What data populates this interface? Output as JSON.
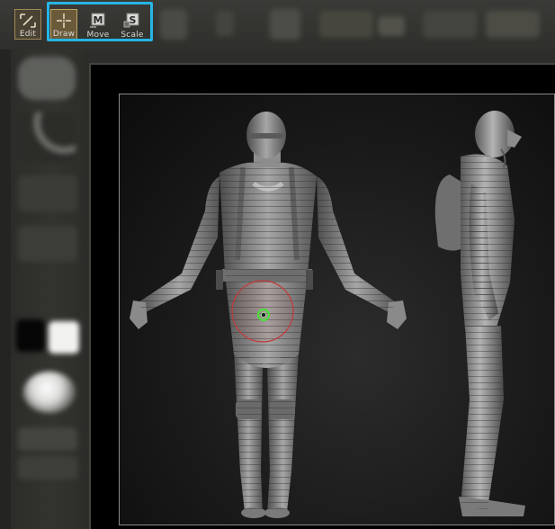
{
  "toolbar": {
    "edit_label": "Edit",
    "draw_label": "Draw",
    "move_label": "Move",
    "scale_label": "Scale",
    "active_tool": "Draw",
    "highlight_color": "#27b5e5"
  },
  "icons": {
    "edit": "edit-mode-icon",
    "draw": "draw-crosshair-icon",
    "move": "move-M-icon",
    "scale": "scale-S-icon"
  },
  "canvas": {
    "background": "#000000",
    "brush_color": "#e03b3b",
    "cursor_color": "#4ddc3a"
  }
}
